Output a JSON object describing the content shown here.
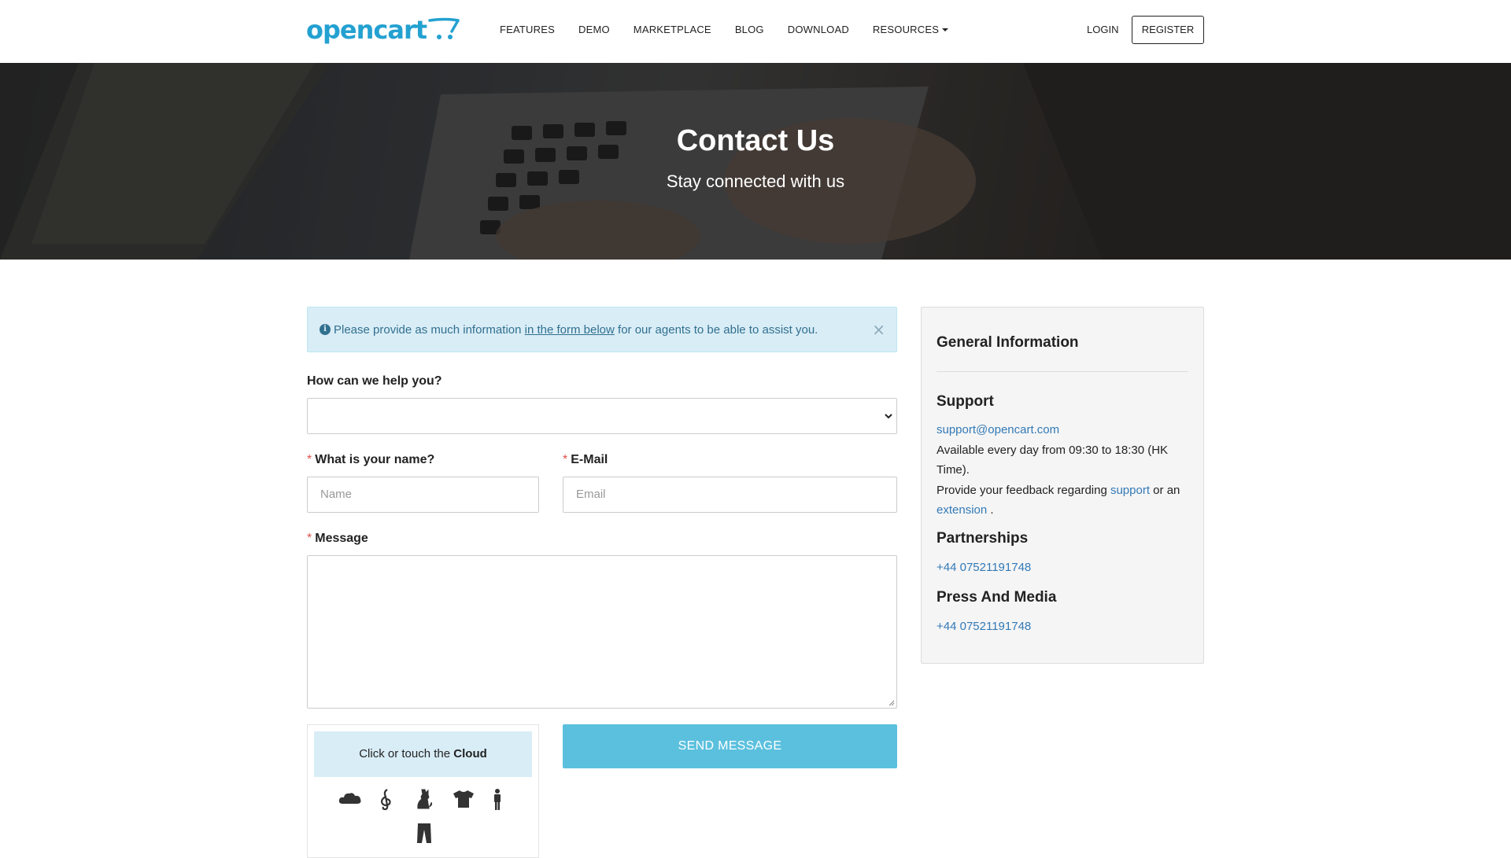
{
  "header": {
    "logo_text": "opencart",
    "nav": [
      {
        "label": "FEATURES"
      },
      {
        "label": "DEMO"
      },
      {
        "label": "MARKETPLACE"
      },
      {
        "label": "BLOG"
      },
      {
        "label": "DOWNLOAD"
      },
      {
        "label": "RESOURCES"
      }
    ],
    "login_label": "LOGIN",
    "register_label": "REGISTER"
  },
  "hero": {
    "title": "Contact Us",
    "subtitle": "Stay connected with us"
  },
  "alert": {
    "text_before": "Please provide as much information ",
    "link_text": "in the form below",
    "text_after": " for our agents to be able to assist you.",
    "close_glyph": "×"
  },
  "form": {
    "help_label": "How can we help you?",
    "help_selected": "",
    "name_label": "What is your name?",
    "name_placeholder": "Name",
    "name_value": "",
    "email_label": "E-Mail",
    "email_placeholder": "Email",
    "email_value": "",
    "message_label": "Message",
    "message_value": "",
    "required_mark": "*",
    "submit_label": "SEND MESSAGE"
  },
  "captcha": {
    "prompt_prefix": "Click or touch the ",
    "prompt_target": "Cloud",
    "icons": [
      "cloud-icon",
      "treble-clef-icon",
      "cat-icon",
      "tshirt-icon",
      "person-icon",
      "trousers-icon"
    ]
  },
  "sidebar": {
    "title": "General Information",
    "support_heading": "Support",
    "support_email": "support@opencart.com",
    "support_hours": "Available every day from 09:30 to 18:30 (HK Time).",
    "feedback_prefix": "Provide your feedback regarding ",
    "feedback_link1": "support",
    "feedback_mid": " or an",
    "feedback_link2": "extension",
    "feedback_suffix": " .",
    "partnerships_heading": "Partnerships",
    "partnerships_phone": "+44 07521191748",
    "press_heading": "Press And Media",
    "press_phone": "+44 07521191748"
  },
  "colors": {
    "brand": "#23a1d1",
    "link": "#337ab7",
    "button": "#5bc0de",
    "alert_bg": "#d9edf7",
    "alert_text": "#31708f",
    "required": "#d9534f"
  }
}
